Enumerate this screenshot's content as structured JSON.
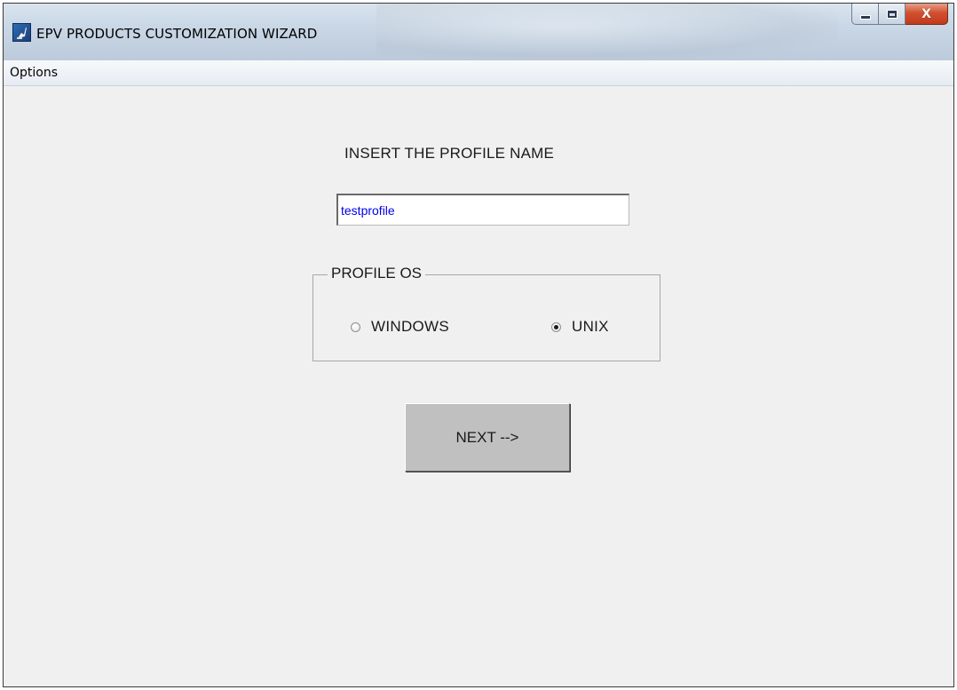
{
  "window": {
    "title": "EPV PRODUCTS CUSTOMIZATION WIZARD",
    "app_icon": "app-icon",
    "caption_buttons": {
      "minimize": "minimize-icon",
      "maximize": "maximize-icon",
      "close": "close-icon",
      "close_glyph": "X"
    }
  },
  "menubar": {
    "items": [
      {
        "label": "Options"
      }
    ]
  },
  "form": {
    "prompt_label": "INSERT THE PROFILE NAME",
    "profile_name": {
      "value": "testprofile",
      "placeholder": ""
    },
    "os_group": {
      "title": "PROFILE OS",
      "options": [
        {
          "label": "WINDOWS",
          "selected": false
        },
        {
          "label": "UNIX",
          "selected": true
        }
      ]
    },
    "next_button": {
      "label": "NEXT -->"
    }
  },
  "colors": {
    "window_bg": "#f0f0f0",
    "input_text": "#0000ee",
    "button_bg": "#c0c0c0",
    "close_button": "#c03a1c"
  }
}
